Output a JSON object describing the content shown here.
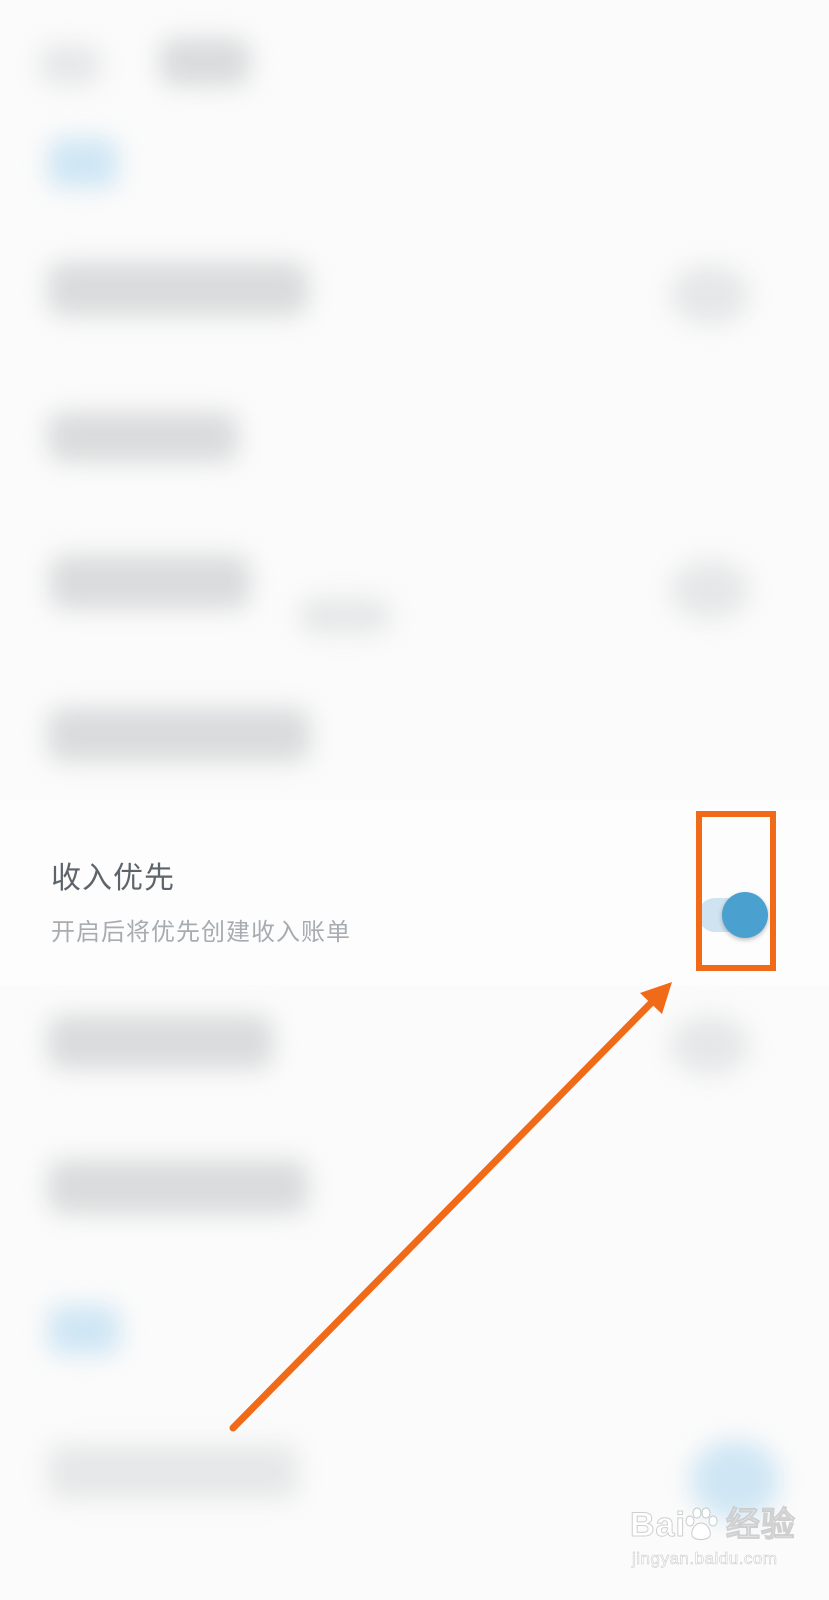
{
  "setting": {
    "title": "收入优先",
    "subtitle": "开启后将优先创建收入账单",
    "toggle_on": true
  },
  "annotation": {
    "highlight_color": "#f06a17"
  },
  "colors": {
    "toggle_thumb": "#4aa0cf",
    "toggle_track": "#cfe3f0",
    "background": "#fbfbfb"
  },
  "watermark": {
    "logo_left": "Bai",
    "logo_right": "经验",
    "url": "jingyan.baidu.com"
  }
}
